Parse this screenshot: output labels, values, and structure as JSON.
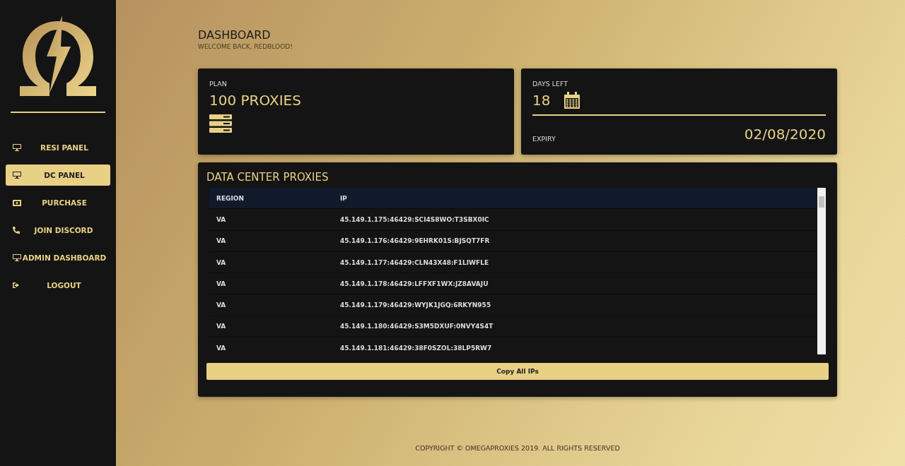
{
  "sidebar": {
    "items": [
      {
        "label": "RESI PANEL",
        "selected": false
      },
      {
        "label": "DC PANEL",
        "selected": true
      },
      {
        "label": "PURCHASE",
        "selected": false
      },
      {
        "label": "JOIN DISCORD",
        "selected": false
      },
      {
        "label": "ADMIN DASHBOARD",
        "selected": false
      },
      {
        "label": "LOGOUT",
        "selected": false
      }
    ]
  },
  "header": {
    "title": "DASHBOARD",
    "subtitle": "WELCOME BACK, REDBLOOD!"
  },
  "plan_card": {
    "label": "PLAN",
    "value": "100 PROXIES"
  },
  "days_card": {
    "label": "DAYS LEFT",
    "value": "18",
    "expiry_label": "EXPIRY",
    "expiry_value": "02/08/2020"
  },
  "proxies": {
    "title": "DATA CENTER PROXIES",
    "columns": [
      "REGION",
      "IP"
    ],
    "rows": [
      [
        "VA",
        "45.149.1.175:46429:SCI4S8WO:T3SBX0IC"
      ],
      [
        "VA",
        "45.149.1.176:46429:9EHRK01S:BJSQT7FR"
      ],
      [
        "VA",
        "45.149.1.177:46429:CLN43X48:F1LIWFLE"
      ],
      [
        "VA",
        "45.149.1.178:46429:LFFXF1WX:JZ8AVAJU"
      ],
      [
        "VA",
        "45.149.1.179:46429:WYJK1JGQ:6RKYN955"
      ],
      [
        "VA",
        "45.149.1.180:46429:S3M5DXUF:0NVY4S4T"
      ],
      [
        "VA",
        "45.149.1.181:46429:38F0SZOL:38LP5RW7"
      ]
    ],
    "button": "Copy All IPs"
  },
  "footer": "COPYRIGHT © OMEGAPROXIES 2019. ALL RIGHTS RESERVED"
}
